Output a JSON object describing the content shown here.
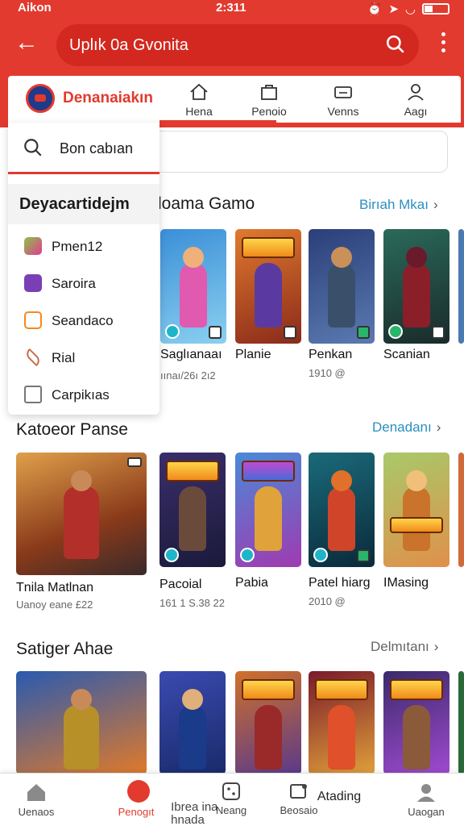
{
  "status": {
    "carrier": "Aikon",
    "time": "2:311"
  },
  "appbar": {
    "search_text": "Uplık 0a Gvonita",
    "icons": [
      "back-arrow-icon",
      "search-icon",
      "more-vertical-icon"
    ]
  },
  "brand": {
    "name": "Denanaiakın"
  },
  "tabs": [
    "Hena",
    "Penoio",
    "Venns",
    "Aagı"
  ],
  "dropdown": {
    "search_text": "Bon cabıan",
    "header": "Deyacartidejm",
    "items": [
      {
        "label": "Pmen12",
        "color": "#8bc34a"
      },
      {
        "label": "Saroira",
        "color": "#7b3fb5"
      },
      {
        "label": "Seandaco",
        "color": "#f08a1a"
      },
      {
        "label": "Rial",
        "color": "#c96a48"
      },
      {
        "label": "Carpikıas",
        "color": "#777777"
      }
    ]
  },
  "section1": {
    "title": "loama Gamo",
    "link": "Birıah Mkaı",
    "games": [
      {
        "name": "Saglıanaaı",
        "meta": "ıınaı/26ı 2ı2",
        "bg": "#3b8fd8",
        "fig": "#e05ab0"
      },
      {
        "name": "Planie",
        "meta": "",
        "bg": "#e07a2e",
        "fig": "#5a3aa0"
      },
      {
        "name": "Penkan",
        "meta": "1910 @",
        "bg": "#2b3f7a",
        "fig": "#3a4f6a"
      },
      {
        "name": "Scanian",
        "meta": "",
        "bg": "#2a6a5a",
        "fig": "#8a1f2a"
      }
    ]
  },
  "section2": {
    "title": "Katoeor Panse",
    "link": "Denadanı",
    "games": [
      {
        "name": "Tnila Matlnan",
        "meta": "Uanoy eane £22",
        "bg": "#c4652a",
        "fig": "#b3302a"
      },
      {
        "name": "Pacoial",
        "meta": "161 1 S.38 22",
        "bg": "#3a2e6a",
        "fig": "#6a4a3a"
      },
      {
        "name": "Pabia",
        "meta": "",
        "bg": "#4a8ad8",
        "fig": "#e0a23a"
      },
      {
        "name": "Patel hiarg",
        "meta": "2010 @",
        "bg": "#1a6a7a",
        "fig": "#d0452a"
      },
      {
        "name": "IMasing",
        "meta": "",
        "bg": "#a8c96a",
        "fig": "#c9742a"
      }
    ]
  },
  "section3": {
    "title": "Satiger Ahae",
    "link": "Delmıtanı",
    "games": [
      {
        "bg": "#2a5ab0",
        "fig": "#b8902a"
      },
      {
        "bg": "#3a4ab0",
        "fig": "#1a3a8a"
      },
      {
        "bg": "#d0702a",
        "fig": "#9a2a2a"
      },
      {
        "bg": "#7a1a2a",
        "fig": "#e0502a"
      },
      {
        "bg": "#3a2a6a",
        "fig": "#8a5a3a"
      }
    ]
  },
  "bottom_nav": [
    {
      "label": "Uenaos",
      "icon": "home-icon",
      "active": false
    },
    {
      "label": "Penogıt",
      "icon": "fire-icon",
      "active": true
    },
    {
      "label": "Ibrea ina\nhnada",
      "icon": "",
      "active": false
    },
    {
      "label": "Neang",
      "icon": "grid-icon",
      "active": false
    },
    {
      "label": "Beosaio",
      "icon": "download-icon",
      "active": false
    },
    {
      "label": "Atading",
      "icon": "",
      "active": false
    },
    {
      "label": "Uaogan",
      "icon": "profile-icon",
      "active": false
    }
  ],
  "colors": {
    "accent": "#e23a2e",
    "link": "#2a8fbf"
  }
}
